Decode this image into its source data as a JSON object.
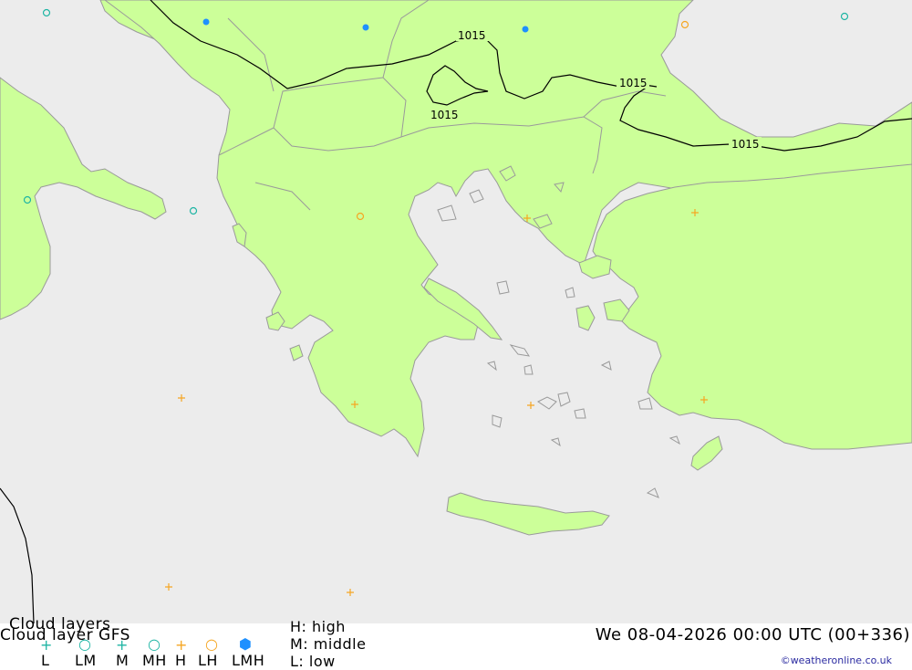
{
  "map": {
    "title_line1": "Cloud layers",
    "title_line2": "Cloud layer  GFS",
    "isobar_label": "1015",
    "datetime": "We 08-04-2026 00:00 UTC (00+336)",
    "credit": "©weatheronline.co.uk",
    "colors": {
      "sea": "#ececec",
      "land": "#ccff99",
      "border": "#9a9a9a",
      "isobar": "#000000",
      "high_cloud": "#f5a623",
      "mid_cloud": "#1fb5a4",
      "low_cloud": "#1fb5a4",
      "lmh_cloud": "#1e90ff"
    }
  },
  "legend": {
    "symbols": [
      {
        "code": "L",
        "icon": "plus-icon",
        "color": "#1fb5a4"
      },
      {
        "code": "LM",
        "icon": "circle-icon",
        "color": "#1fb5a4"
      },
      {
        "code": "M",
        "icon": "plus-icon",
        "color": "#1fb5a4"
      },
      {
        "code": "MH",
        "icon": "circle-icon",
        "color": "#1fb5a4"
      },
      {
        "code": "H",
        "icon": "plus-icon",
        "color": "#f5a623"
      },
      {
        "code": "LH",
        "icon": "circle-icon",
        "color": "#f5a623"
      },
      {
        "code": "LMH",
        "icon": "filled-hexagon-icon",
        "color": "#1e90ff"
      }
    ],
    "key": {
      "high": "H: high",
      "middle": "M: middle",
      "low": "L: low"
    }
  }
}
